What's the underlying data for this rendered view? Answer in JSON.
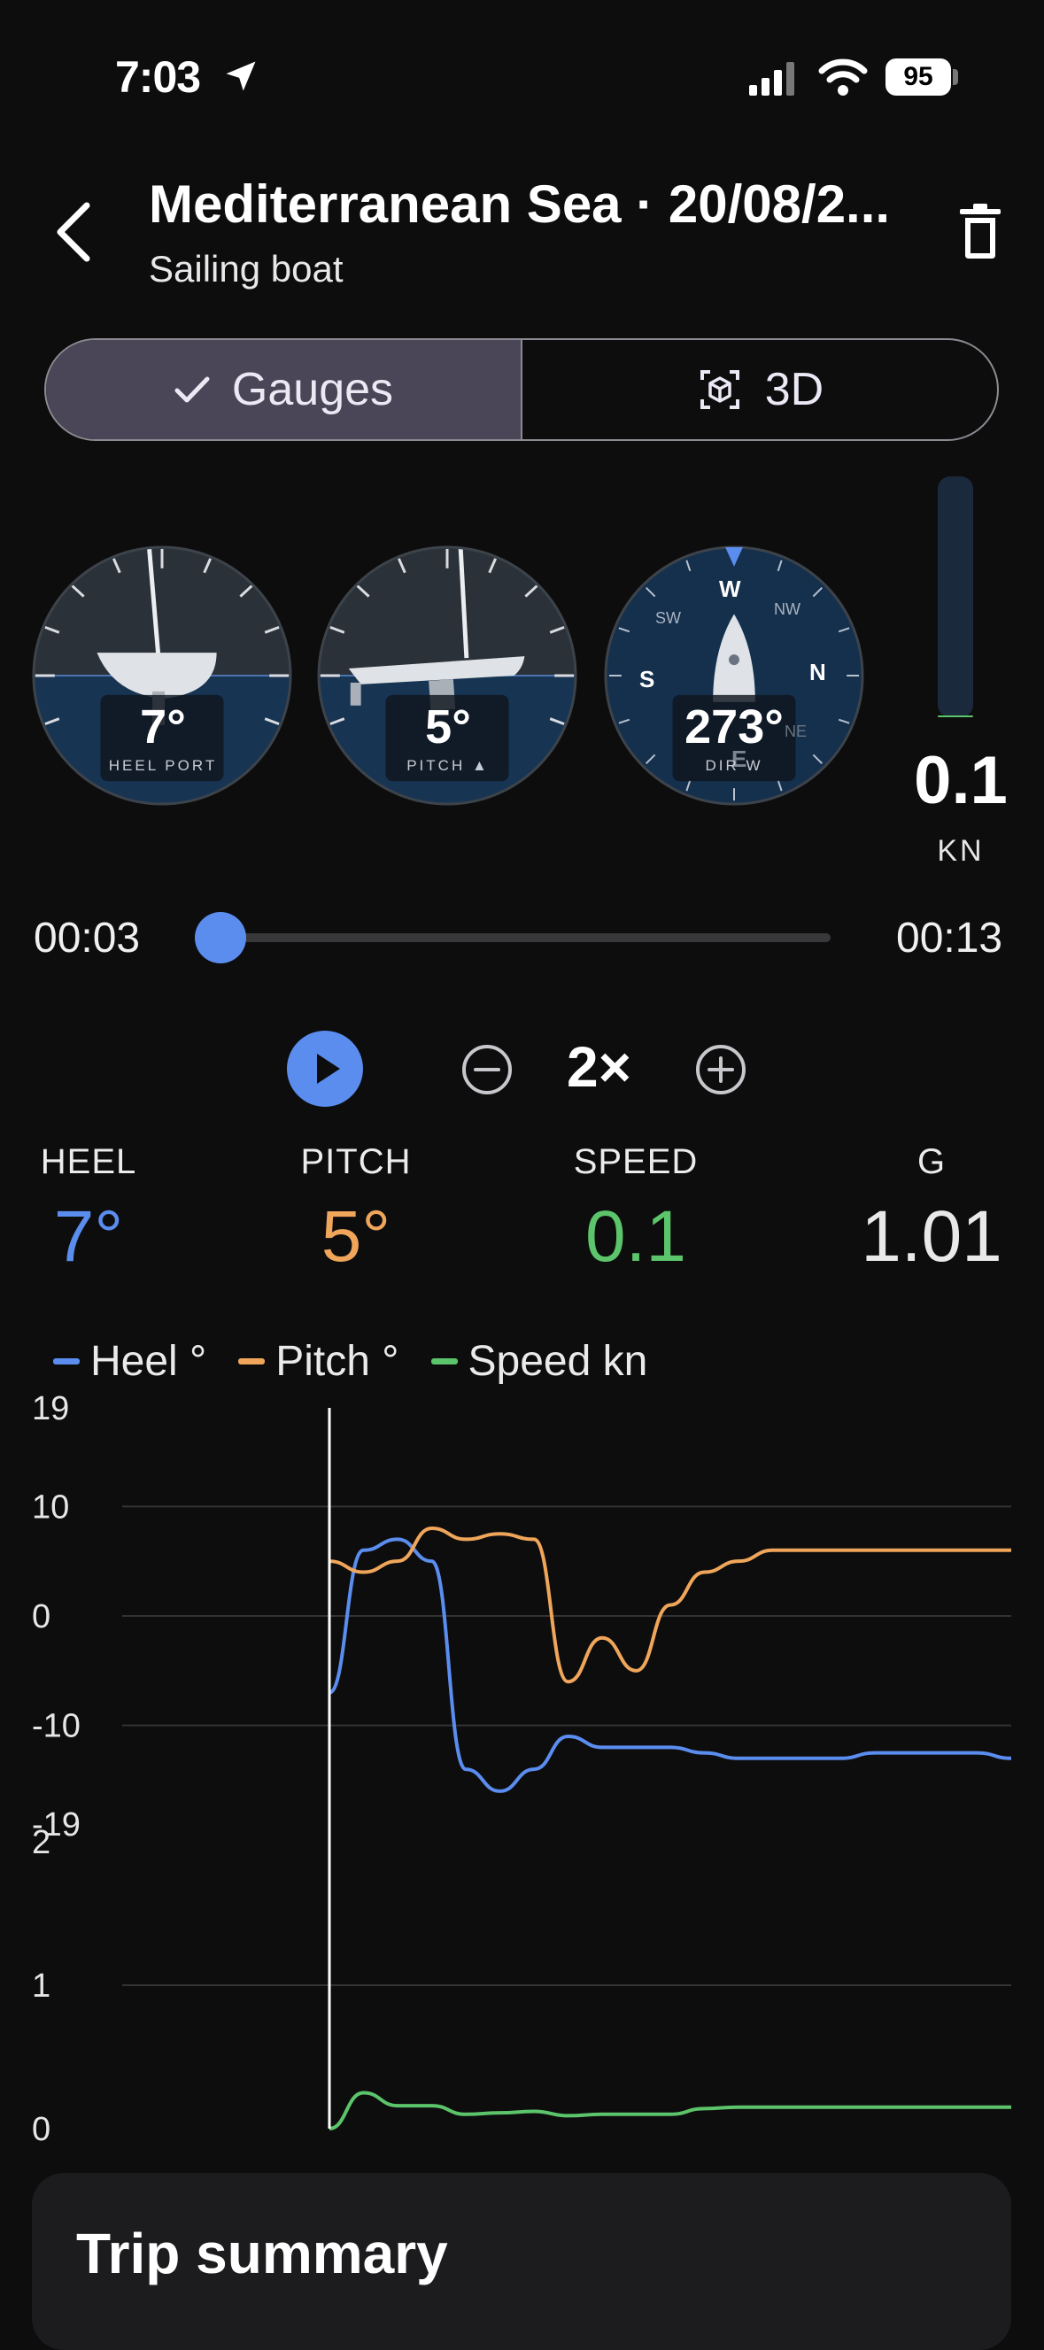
{
  "status_bar": {
    "time": "7:03",
    "battery": "95"
  },
  "header": {
    "title": "Mediterranean Sea · 20/08/2...",
    "subtitle": "Sailing boat"
  },
  "segmented": {
    "gauges_label": "Gauges",
    "three_d_label": "3D"
  },
  "gauges": {
    "heel": {
      "value": "7°",
      "label": "HEEL PORT"
    },
    "pitch": {
      "value": "5°",
      "label": "PITCH ▲"
    },
    "direction": {
      "value": "273°",
      "label": "DIR W",
      "cardinals": [
        "W",
        "N",
        "S",
        "E"
      ],
      "intercardinals": [
        "NW",
        "SW",
        "NE"
      ]
    }
  },
  "speed_meter": {
    "value": "0.1",
    "unit": "KN",
    "level": 0.005
  },
  "playback": {
    "current_time": "00:03",
    "end_time": "00:13",
    "progress": 0.0,
    "rate": "2×"
  },
  "stats": [
    {
      "label": "HEEL",
      "value": "7°",
      "color": "#5b8def"
    },
    {
      "label": "PITCH",
      "value": "5°",
      "color": "#f0a65a"
    },
    {
      "label": "SPEED",
      "value": "0.1",
      "color": "#5cc46a"
    },
    {
      "label": "G",
      "value": "1.01",
      "color": "#e9e9e9"
    }
  ],
  "legend": [
    "Heel °",
    "Pitch °",
    "Speed kn"
  ],
  "colors": {
    "heel": "#5b8def",
    "pitch": "#f0a65a",
    "speed": "#5cc46a",
    "accent": "#5b8def"
  },
  "chart_data": [
    {
      "type": "line",
      "x": [
        0,
        0.5,
        1,
        1.5,
        2,
        2.5,
        3,
        3.5,
        4,
        4.5,
        5,
        5.5,
        6,
        6.5,
        7,
        7.5,
        8,
        8.5,
        9,
        9.5,
        10
      ],
      "yticks": [
        19,
        10,
        0,
        -10,
        -19
      ],
      "ylim": [
        -19,
        19
      ],
      "series": [
        {
          "name": "Heel °",
          "values": [
            -7,
            6,
            7,
            5,
            -14,
            -16,
            -14,
            -11,
            -12,
            -12,
            -12,
            -12.5,
            -13,
            -13,
            -13,
            -13,
            -12.5,
            -12.5,
            -12.5,
            -12.5,
            -13
          ]
        },
        {
          "name": "Pitch °",
          "values": [
            5,
            4,
            5,
            8,
            7,
            7.5,
            7,
            -6,
            -2,
            -5,
            1,
            4,
            5,
            6,
            6,
            6,
            6,
            6,
            6,
            6,
            6
          ]
        }
      ]
    },
    {
      "type": "line",
      "x": [
        0,
        0.5,
        1,
        1.5,
        2,
        2.5,
        3,
        3.5,
        4,
        4.5,
        5,
        5.5,
        6,
        6.5,
        7,
        7.5,
        8,
        8.5,
        9,
        9.5,
        10
      ],
      "yticks": [
        2,
        1,
        0
      ],
      "ylim": [
        0,
        2
      ],
      "series": [
        {
          "name": "Speed kn",
          "values": [
            0,
            0.25,
            0.16,
            0.16,
            0.1,
            0.11,
            0.12,
            0.09,
            0.1,
            0.1,
            0.1,
            0.14,
            0.15,
            0.15,
            0.15,
            0.15,
            0.15,
            0.15,
            0.15,
            0.15,
            0.15
          ]
        }
      ]
    }
  ],
  "summary": {
    "title": "Trip summary"
  }
}
